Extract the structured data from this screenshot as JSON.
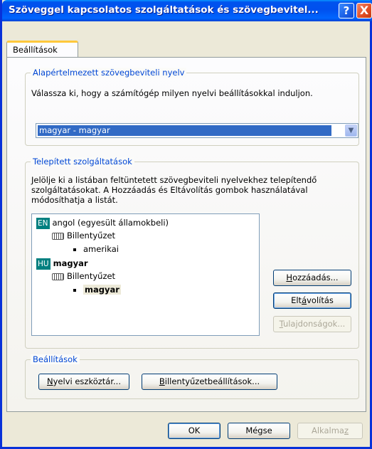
{
  "window": {
    "title": "Szöveggel kapcsolatos szolgáltatások és szövegbevitel...",
    "help_label": "?",
    "close_label": "X"
  },
  "tab": {
    "label": "Beállítások"
  },
  "default_language": {
    "group_title": "Alapértelmezett szövegbeviteli nyelv",
    "description": "Válassza ki, hogy a számítógép milyen nyelvi beállításokkal induljon.",
    "selected": "magyar - magyar"
  },
  "installed_services": {
    "group_title": "Telepített szolgáltatások",
    "description_lines": [
      "Jelölje ki a listában feltüntetett szövegbeviteli nyelvekhez telepítendő",
      "szolgáltatásokat. A Hozzáadás és Eltávolítás gombok használatával",
      "módosíthatja a listát."
    ],
    "languages": [
      {
        "badge": "EN",
        "name": "angol (egyesült államokbeli)",
        "category": "Billentyűzet",
        "layout": "amerikai"
      },
      {
        "badge": "HU",
        "name": "magyar",
        "category": "Billentyűzet",
        "layout": "magyar"
      }
    ],
    "add_button": {
      "pre": "",
      "ul": "H",
      "post": "ozzáadás..."
    },
    "remove_button": {
      "pre": "Elt",
      "ul": "á",
      "post": "volítás"
    },
    "properties_button": {
      "pre": "",
      "ul": "T",
      "post": "ulajdonságok..."
    }
  },
  "settings_group": {
    "group_title": "Beállítások",
    "langbar_button": {
      "pre": "",
      "ul": "N",
      "post": "yelvi eszköztár..."
    },
    "keyboard_button": {
      "pre": "",
      "ul": "B",
      "post": "illentyűzetbeállítások..."
    }
  },
  "footer": {
    "ok": "OK",
    "cancel": "Mégse",
    "apply": {
      "pre": "Alkalma",
      "ul": "z",
      "post": ""
    }
  }
}
